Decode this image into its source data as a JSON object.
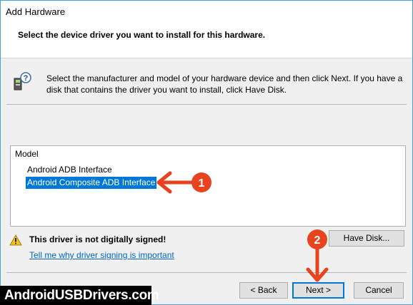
{
  "window": {
    "title": "Add Hardware"
  },
  "header": {
    "heading": "Select the device driver you want to install for this hardware."
  },
  "description": "Select the manufacturer and model of your hardware device and then click Next. If you have a disk that contains the driver you want to install, click Have Disk.",
  "model_list": {
    "header": "Model",
    "items": [
      {
        "label": "Android ADB Interface",
        "selected": false
      },
      {
        "label": "Android Composite ADB Interface",
        "selected": true
      }
    ]
  },
  "warning": {
    "text": "This driver is not digitally signed!",
    "link": "Tell me why driver signing is important"
  },
  "buttons": {
    "have_disk": "Have Disk...",
    "back": "< Back",
    "next": "Next >",
    "cancel": "Cancel"
  },
  "annotations": {
    "step1": "1",
    "step2": "2",
    "color": "#e8431f"
  },
  "watermark": "AndroidUSBDrivers.com"
}
